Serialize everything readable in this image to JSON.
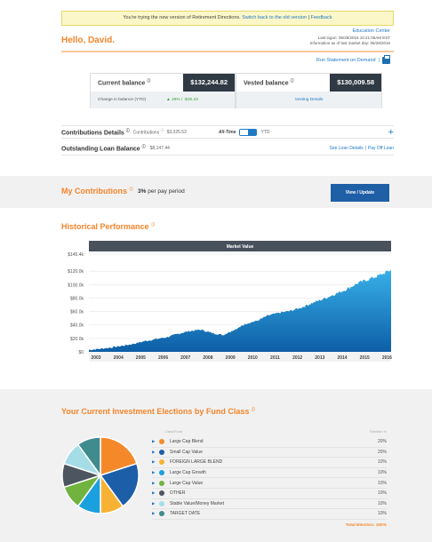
{
  "banner": {
    "text": "You're trying the new version of Retirement Directions.",
    "switch_link": "Switch back to the old version",
    "sep": "|",
    "feedback": "Feedback"
  },
  "header": {
    "greeting": "Hello, David.",
    "education_center": "Education Center",
    "last_logon": "Last logon: 06/28/2016 10:21:05AM EST",
    "info_date": "Information as of last market day: 06/28/2016",
    "run_statement": "Run Statement on Demand",
    "run_sep": "|"
  },
  "balances": {
    "current_label": "Current balance",
    "current_value": "$132,244.82",
    "change_label": "Change in balance (YTD)",
    "change_value": "25% / -$30.43",
    "vested_label": "Vested balance",
    "vested_value": "$130,009.58",
    "vesting_details": "Vesting Details",
    "info_mark": "ⓘ"
  },
  "contributions": {
    "title": "Contributions Details",
    "sub_label": "Contributions",
    "sub_value": "$3,325.53",
    "all_time": "All-Time",
    "ytd": "YTD",
    "plus": "+"
  },
  "loan": {
    "title": "Outstanding Loan Balance",
    "value": "$8,147.44",
    "details_link": "See Loan Details",
    "sep": "|",
    "payoff_link": "Pay Off Loan"
  },
  "my_contributions": {
    "title": "My Contributions",
    "rate": "3%",
    "rate_suffix": "per pay period",
    "button": "View / Update"
  },
  "historical": {
    "title": "Historical Performance"
  },
  "chart_data": {
    "type": "area",
    "title": "Market Value",
    "y_ticks": [
      "$0",
      "$20.0k",
      "$40.0k",
      "$60.0k",
      "$80.0k",
      "$100.0k",
      "$120.0k",
      "$145.4k"
    ],
    "ylim": [
      0,
      145400
    ],
    "x_ticks": [
      "2003",
      "2004",
      "2005",
      "2006",
      "2007",
      "2008",
      "2009",
      "2010",
      "2011",
      "2012",
      "2013",
      "2014",
      "2015",
      "2016"
    ],
    "xlim": [
      2003,
      2016.5
    ],
    "x": [
      2003,
      2003.5,
      2004,
      2004.5,
      2005,
      2005.5,
      2006,
      2006.5,
      2007,
      2007.5,
      2008,
      2008.5,
      2009,
      2009.3,
      2009.7,
      2010,
      2010.5,
      2011,
      2011.5,
      2012,
      2012.5,
      2013,
      2013.5,
      2014,
      2014.5,
      2015,
      2015.5,
      2016,
      2016.5
    ],
    "y": [
      3000,
      4500,
      6500,
      9000,
      12000,
      16000,
      19000,
      22000,
      27000,
      31000,
      33000,
      28000,
      25000,
      30000,
      36000,
      42000,
      46000,
      54000,
      58000,
      61000,
      66000,
      73000,
      79000,
      86000,
      93000,
      102000,
      108000,
      114000,
      122000
    ],
    "fill": "#1a82c4",
    "header_bg": "#48515c"
  },
  "elections": {
    "title": "Your Current Investment Elections by Fund Class",
    "col_fund": "Class/Fund",
    "col_pct": "Election %",
    "funds": [
      {
        "name": "Large Cap Blend",
        "pct": "20%",
        "value": 20,
        "color": "#f5892a"
      },
      {
        "name": "Small Cap Value",
        "pct": "20%",
        "value": 20,
        "color": "#1d5ea8"
      },
      {
        "name": "FOREIGN LARGE BLEND",
        "pct": "10%",
        "value": 10,
        "color": "#f7b233"
      },
      {
        "name": "Large Cap Growth",
        "pct": "10%",
        "value": 10,
        "color": "#1aa0de"
      },
      {
        "name": "Large Cap Value",
        "pct": "10%",
        "value": 10,
        "color": "#71b33f"
      },
      {
        "name": "OTHER",
        "pct": "10%",
        "value": 10,
        "color": "#4d5660"
      },
      {
        "name": "Stable Value/Money Market",
        "pct": "10%",
        "value": 10,
        "color": "#a5dde6"
      },
      {
        "name": "TARGET DATE",
        "pct": "10%",
        "value": 10,
        "color": "#3f8b8e"
      }
    ],
    "total": "Total Election: 100%"
  }
}
